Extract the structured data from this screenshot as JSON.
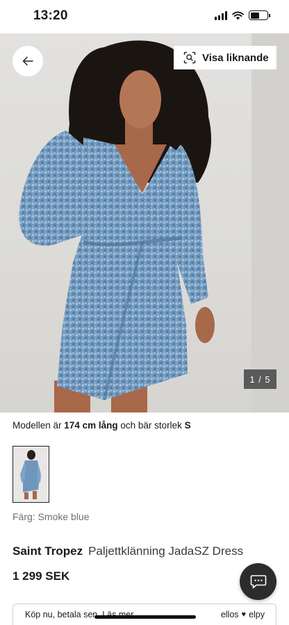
{
  "status_bar": {
    "time": "13:20"
  },
  "hero": {
    "similar_label": "Visa liknande",
    "image_counter": "1 / 5",
    "image_alt": "Model wearing a blue sequin wrap dress"
  },
  "model_info": {
    "prefix": "Modellen är ",
    "height": "174 cm lång",
    "middle": " och bär storlek ",
    "size": "S"
  },
  "color": {
    "label": "Färg: Smoke blue",
    "swatch": "#6f97bd"
  },
  "product": {
    "brand": "Saint Tropez",
    "name": "Paljettklänning JadaSZ Dress",
    "price": "1 299 SEK"
  },
  "pay_later": {
    "text": "Köp nu, betala sen.",
    "link": "Läs mer",
    "provider_left": "ellos",
    "provider_right": "elpy"
  },
  "icons": {
    "back": "arrow-left-icon",
    "similar": "visual-search-icon",
    "chat": "chat-bubble-icon"
  },
  "colors": {
    "accent_dark": "#2c2c2c",
    "dress_blue": "#6f97bd",
    "counter_bg": "#5a5a5a"
  }
}
